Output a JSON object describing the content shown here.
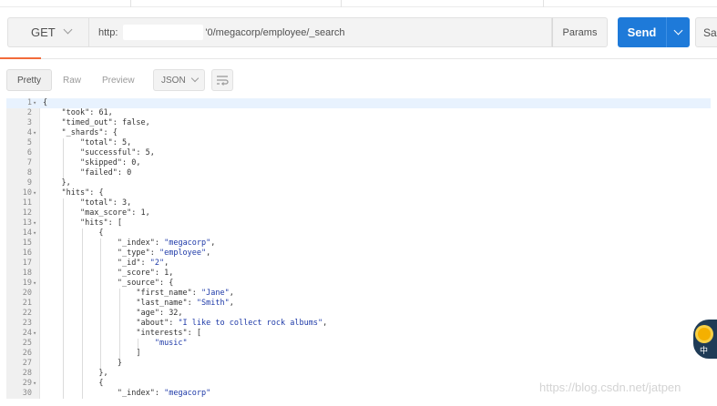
{
  "request": {
    "method": "GET",
    "url_prefix": "http:",
    "url_rest": "'0/megacorp/employee/_search",
    "params_label": "Params",
    "send_label": "Send",
    "save_label": "Sa"
  },
  "response_view": {
    "tabs": [
      "Pretty",
      "Raw",
      "Preview"
    ],
    "active_tab": "Pretty",
    "format": "JSON",
    "icons": {
      "wrap": "wrap-lines-icon",
      "dropdown": "chevron-down-icon",
      "fold": "fold-arrow-icon"
    }
  },
  "code": {
    "lines": [
      "{",
      "    \"took\": 61,",
      "    \"timed_out\": false,",
      "    \"_shards\": {",
      "        \"total\": 5,",
      "        \"successful\": 5,",
      "        \"skipped\": 0,",
      "        \"failed\": 0",
      "    },",
      "    \"hits\": {",
      "        \"total\": 3,",
      "        \"max_score\": 1,",
      "        \"hits\": [",
      "            {",
      "                \"_index\": \"megacorp\",",
      "                \"_type\": \"employee\",",
      "                \"_id\": \"2\",",
      "                \"_score\": 1,",
      "                \"_source\": {",
      "                    \"first_name\": \"Jane\",",
      "                    \"last_name\": \"Smith\",",
      "                    \"age\": 32,",
      "                    \"about\": \"I like to collect rock albums\",",
      "                    \"interests\": [",
      "                        \"music\"",
      "                    ]",
      "                }",
      "            },",
      "            {",
      "                \"_index\": \"megacorp\""
    ],
    "foldable_lines": [
      1,
      4,
      10,
      13,
      14,
      19,
      24,
      29
    ],
    "active_line": 1
  },
  "floating_badge": {
    "icon": "assistant-badge-icon",
    "text": "中"
  },
  "watermark": "https://blog.csdn.net/jatpen",
  "colors": {
    "send_blue": "#1e7ad9",
    "tab_indicator": "#f26b3a",
    "json_string": "#1e3aa8",
    "active_line_bg": "#e8f2fe"
  }
}
